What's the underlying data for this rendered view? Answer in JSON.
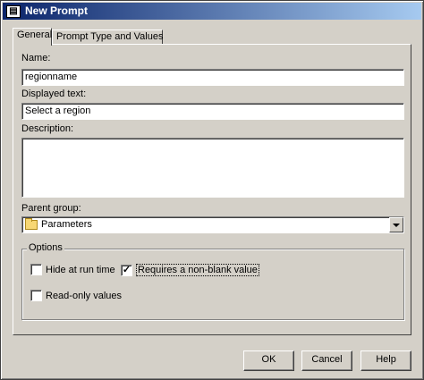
{
  "window": {
    "title": "New Prompt",
    "icon": "prompt-app-icon"
  },
  "tabs": [
    {
      "label": "General",
      "active": true
    },
    {
      "label": "Prompt Type and Values",
      "active": false
    }
  ],
  "form": {
    "name_label": "Name:",
    "name_value": "regionname",
    "displayed_text_label": "Displayed text:",
    "displayed_text_value": "Select a region",
    "description_label": "Description:",
    "description_value": "",
    "parent_group_label": "Parent group:",
    "parent_group_value": "Parameters"
  },
  "options": {
    "title": "Options",
    "hide_at_run_time": {
      "label": "Hide at run time",
      "checked": false
    },
    "requires_non_blank": {
      "label": "Requires a non-blank value",
      "checked": true
    },
    "read_only": {
      "label": "Read-only values",
      "checked": false
    }
  },
  "buttons": {
    "ok": "OK",
    "cancel": "Cancel",
    "help": "Help"
  },
  "check_glyph": "✓"
}
